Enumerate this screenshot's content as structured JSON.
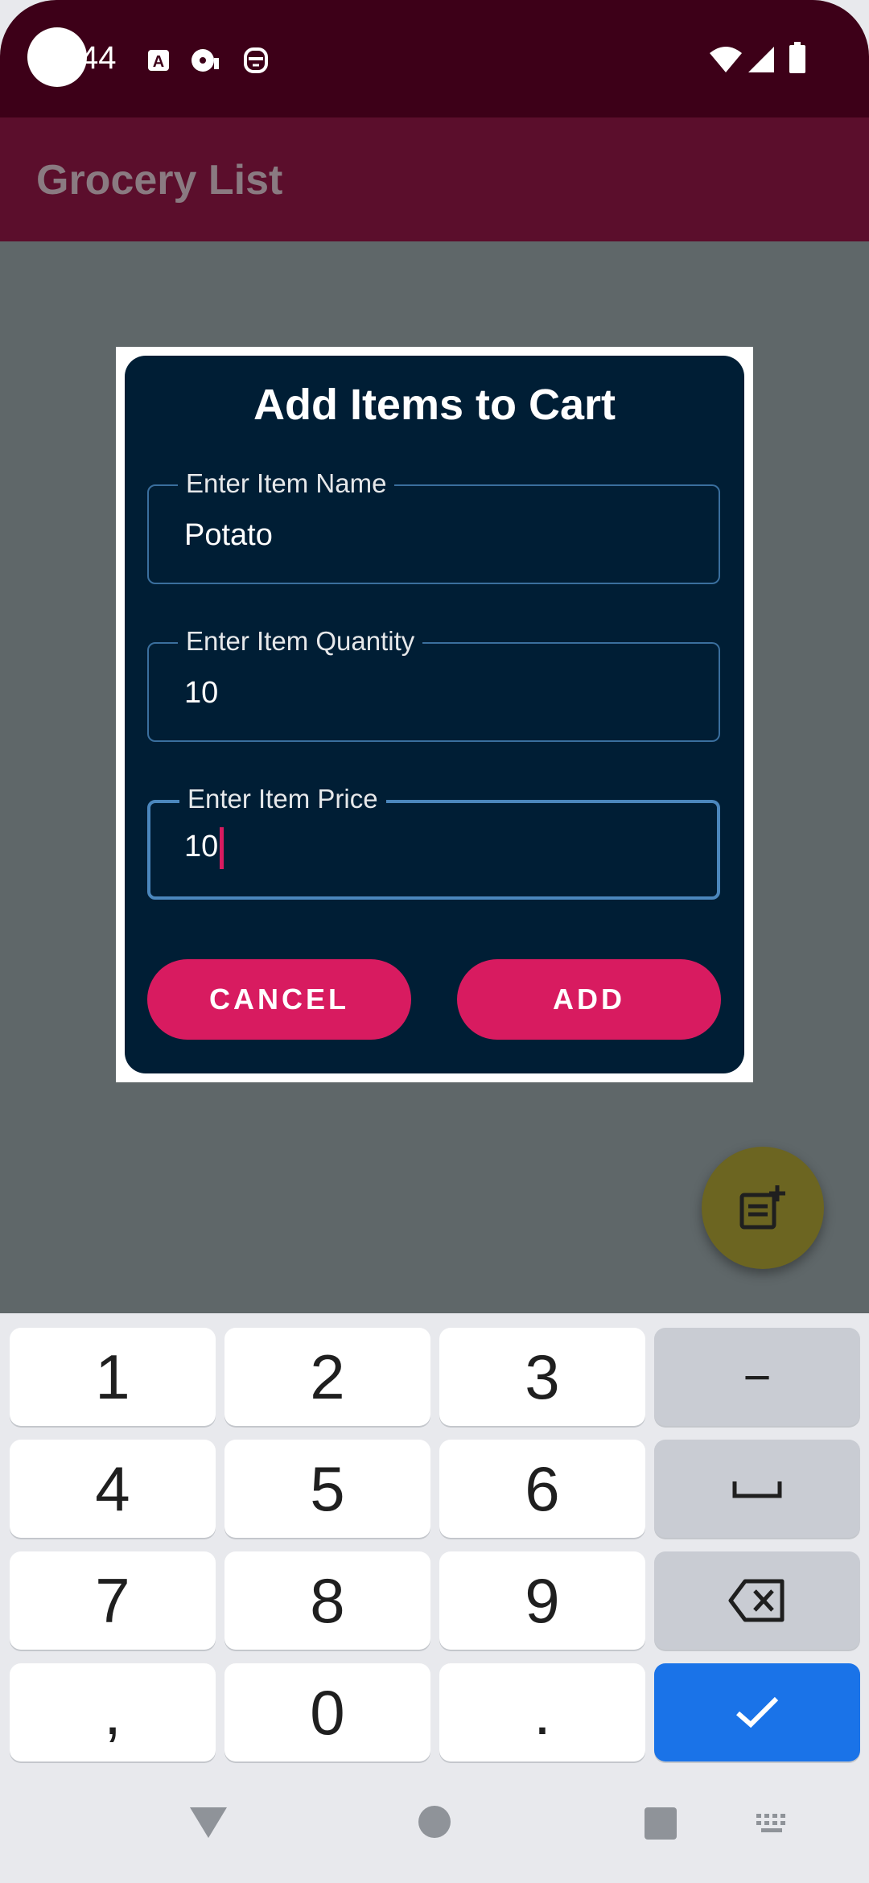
{
  "status_bar": {
    "time": "44",
    "icons": [
      "keyboard-a-icon",
      "media-icon",
      "face-icon",
      "wifi-icon",
      "cellular-icon",
      "battery-icon"
    ]
  },
  "app": {
    "title": "Grocery List"
  },
  "dialog": {
    "title": "Add Items to Cart",
    "fields": [
      {
        "label": "Enter Item Name",
        "value": "Potato"
      },
      {
        "label": "Enter Item Quantity",
        "value": "10"
      },
      {
        "label": "Enter Item Price",
        "value": "10"
      }
    ],
    "cancel_label": "CANCEL",
    "add_label": "ADD"
  },
  "fab": {
    "icon": "note-add-icon"
  },
  "keyboard": {
    "rows": [
      [
        "1",
        "2",
        "3",
        "−"
      ],
      [
        "4",
        "5",
        "6",
        "space"
      ],
      [
        "7",
        "8",
        "9",
        "backspace"
      ],
      [
        ",",
        "0",
        ".",
        "done"
      ]
    ]
  },
  "nav": {
    "icons": [
      "back-icon",
      "home-icon",
      "recents-icon",
      "keyboard-switch-icon"
    ]
  },
  "colors": {
    "status_bar": "#3d0018",
    "app_bar": "#5b0e2c",
    "dialog_bg": "#001e35",
    "accent": "#d81b60",
    "field_border": "#3a6f9e",
    "fab": "#6c6521",
    "key_action": "#1a73e8"
  }
}
